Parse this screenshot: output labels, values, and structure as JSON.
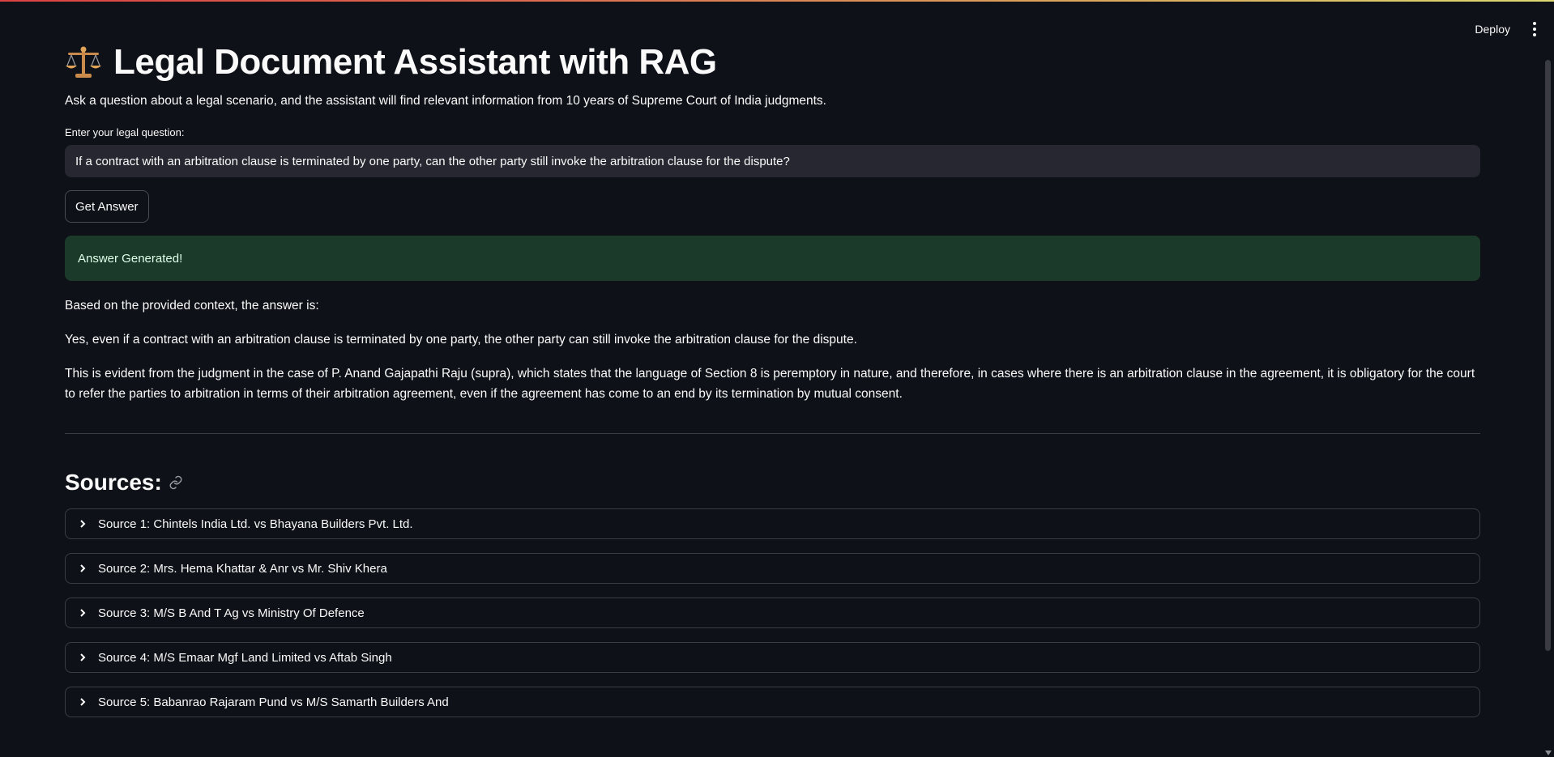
{
  "header": {
    "deploy_label": "Deploy",
    "menu_icon": "kebab-menu-icon"
  },
  "title": {
    "icon": "scales-of-justice-icon",
    "text": "Legal Document Assistant with RAG"
  },
  "subtitle": "Ask a question about a legal scenario, and the assistant will find relevant information from 10 years of Supreme Court of India judgments.",
  "question": {
    "label": "Enter your legal question:",
    "value": "If a contract with an arbitration clause is terminated by one party, can the other party still invoke the arbitration clause for the dispute?"
  },
  "get_answer_label": "Get Answer",
  "success_message": "Answer Generated!",
  "answer": {
    "p1": "Based on the provided context, the answer is:",
    "p2": "Yes, even if a contract with an arbitration clause is terminated by one party, the other party can still invoke the arbitration clause for the dispute.",
    "p3": "This is evident from the judgment in the case of P. Anand Gajapathi Raju (supra), which states that the language of Section 8 is peremptory in nature, and therefore, in cases where there is an arbitration clause in the agreement, it is obligatory for the court to refer the parties to arbitration in terms of their arbitration agreement, even if the agreement has come to an end by its termination by mutual consent."
  },
  "sources": {
    "heading": "Sources:",
    "items": [
      {
        "label": "Source 1: Chintels India Ltd. vs Bhayana Builders Pvt. Ltd."
      },
      {
        "label": "Source 2: Mrs. Hema Khattar & Anr vs Mr. Shiv Khera"
      },
      {
        "label": "Source 3: M/S B And T Ag vs Ministry Of Defence"
      },
      {
        "label": "Source 4: M/S Emaar Mgf Land Limited vs Aftab Singh"
      },
      {
        "label": "Source 5: Babanrao Rajaram Pund vs M/S Samarth Builders And"
      }
    ]
  },
  "colors": {
    "background": "#0e1117",
    "input_bg": "#262730",
    "success_bg": "#1c3a29",
    "text": "#fafafa"
  }
}
